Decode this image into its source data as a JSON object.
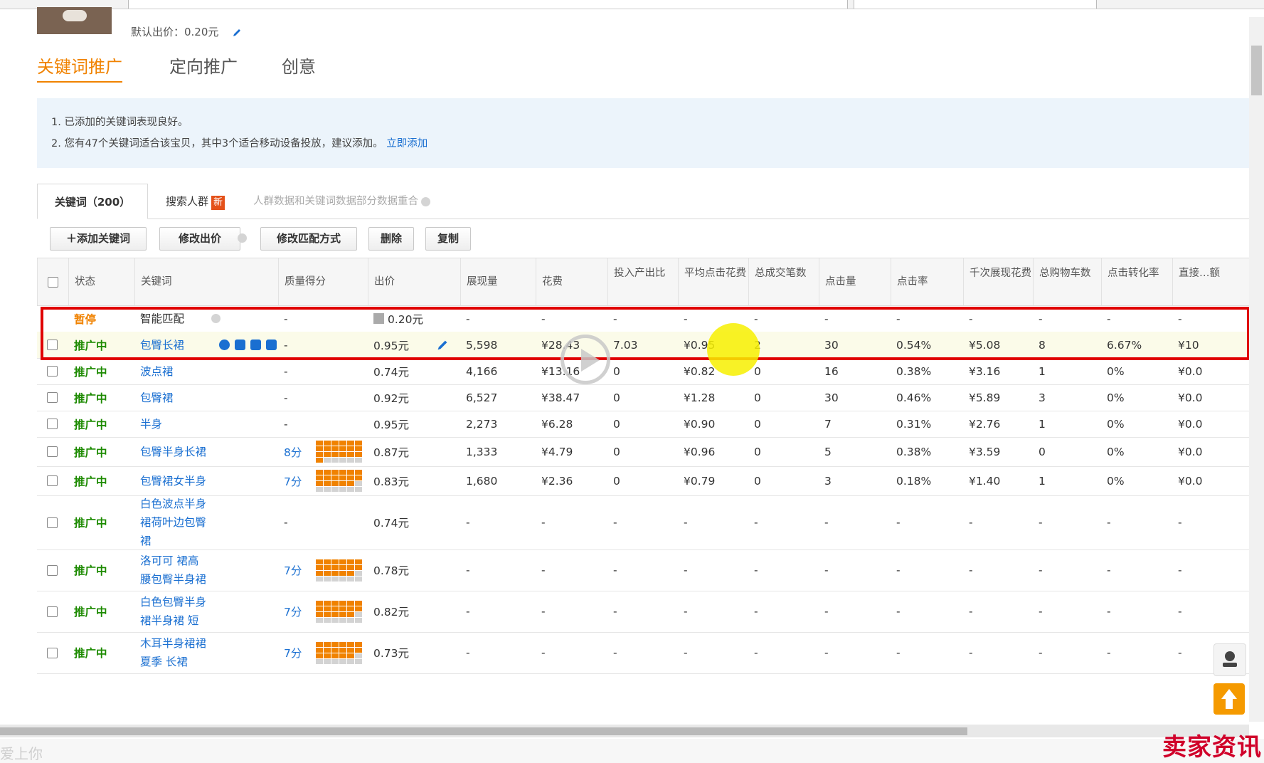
{
  "default_bid": "默认出价：0.20元",
  "tabs": [
    "关键词推广",
    "定向推广",
    "创意"
  ],
  "notice": {
    "line1": "1. 已添加的关键词表现良好。",
    "line2": "2. 您有47个关键词适合该宝贝，其中3个适合移动设备投放，建议添加。",
    "line2_link": "立即添加"
  },
  "subtabs": {
    "keywords": "关键词（200）",
    "search_crowd": "搜索人群",
    "new_badge": "新",
    "note": "人群数据和关键词数据部分数据重合"
  },
  "toolbar": {
    "add_keyword": "＋添加关键词",
    "modify_bid": "修改出价",
    "modify_match": "修改匹配方式",
    "delete": "删除",
    "copy": "复制"
  },
  "columns": [
    "状态",
    "关键词",
    "质量得分",
    "出价",
    "展现量",
    "花费",
    "投入产出比",
    "平均点击花费",
    "总成交笔数",
    "点击量",
    "点击率",
    "千次展现花费",
    "总购物车数",
    "点击转化率",
    "直接…额"
  ],
  "rows": [
    {
      "status": "暂停",
      "status_type": "pause",
      "keyword": "智能匹配",
      "score": "-",
      "quality": null,
      "bid": "0.20元",
      "impr": "-",
      "cost": "-",
      "roi": "-",
      "cpc": "-",
      "orders": "-",
      "clicks": "-",
      "ctr": "-",
      "cpm": "-",
      "cart": "-",
      "cvr": "-",
      "direct": "-"
    },
    {
      "status": "推广中",
      "status_type": "on",
      "keyword": "包臀长裙",
      "score": "-",
      "quality": null,
      "bid": "0.95元",
      "impr": "5,598",
      "cost": "¥28.43",
      "roi": "7.03",
      "cpc": "¥0.95",
      "orders": "2",
      "clicks": "30",
      "ctr": "0.54%",
      "cpm": "¥5.08",
      "cart": "8",
      "cvr": "6.67%",
      "direct": "¥10"
    },
    {
      "status": "推广中",
      "status_type": "on",
      "keyword": "波点裙",
      "score": "-",
      "quality": null,
      "bid": "0.74元",
      "impr": "4,166",
      "cost": "¥13.16",
      "roi": "0",
      "cpc": "¥0.82",
      "orders": "0",
      "clicks": "16",
      "ctr": "0.38%",
      "cpm": "¥3.16",
      "cart": "1",
      "cvr": "0%",
      "direct": "¥0.0"
    },
    {
      "status": "推广中",
      "status_type": "on",
      "keyword": "包臀裙",
      "score": "-",
      "quality": null,
      "bid": "0.92元",
      "impr": "6,527",
      "cost": "¥38.47",
      "roi": "0",
      "cpc": "¥1.28",
      "orders": "0",
      "clicks": "30",
      "ctr": "0.46%",
      "cpm": "¥5.89",
      "cart": "3",
      "cvr": "0%",
      "direct": "¥0.0"
    },
    {
      "status": "推广中",
      "status_type": "on",
      "keyword": "半身",
      "score": "-",
      "quality": null,
      "bid": "0.95元",
      "impr": "2,273",
      "cost": "¥6.28",
      "roi": "0",
      "cpc": "¥0.90",
      "orders": "0",
      "clicks": "7",
      "ctr": "0.31%",
      "cpm": "¥2.76",
      "cart": "1",
      "cvr": "0%",
      "direct": "¥0.0"
    },
    {
      "status": "推广中",
      "status_type": "on",
      "keyword": "包臀半身长裙",
      "score": "8分",
      "quality": 8,
      "bid": "0.87元",
      "impr": "1,333",
      "cost": "¥4.79",
      "roi": "0",
      "cpc": "¥0.96",
      "orders": "0",
      "clicks": "5",
      "ctr": "0.38%",
      "cpm": "¥3.59",
      "cart": "0",
      "cvr": "0%",
      "direct": "¥0.0"
    },
    {
      "status": "推广中",
      "status_type": "on",
      "keyword": "包臀裙女半身",
      "score": "7分",
      "quality": 7,
      "bid": "0.83元",
      "impr": "1,680",
      "cost": "¥2.36",
      "roi": "0",
      "cpc": "¥0.79",
      "orders": "0",
      "clicks": "3",
      "ctr": "0.18%",
      "cpm": "¥1.40",
      "cart": "1",
      "cvr": "0%",
      "direct": "¥0.0"
    },
    {
      "status": "推广中",
      "status_type": "on",
      "keyword": "白色波点半身裙荷叶边包臀裙",
      "score": "-",
      "quality": null,
      "bid": "0.74元",
      "impr": "-",
      "cost": "-",
      "roi": "-",
      "cpc": "-",
      "orders": "-",
      "clicks": "-",
      "ctr": "-",
      "cpm": "-",
      "cart": "-",
      "cvr": "-",
      "direct": "-"
    },
    {
      "status": "推广中",
      "status_type": "on",
      "keyword": "洛可可 裙高腰包臀半身裙",
      "score": "7分",
      "quality": 7,
      "bid": "0.78元",
      "impr": "-",
      "cost": "-",
      "roi": "-",
      "cpc": "-",
      "orders": "-",
      "clicks": "-",
      "ctr": "-",
      "cpm": "-",
      "cart": "-",
      "cvr": "-",
      "direct": "-"
    },
    {
      "status": "推广中",
      "status_type": "on",
      "keyword": "白色包臀半身裙半身裙 短",
      "score": "7分",
      "quality": 7,
      "bid": "0.82元",
      "impr": "-",
      "cost": "-",
      "roi": "-",
      "cpc": "-",
      "orders": "-",
      "clicks": "-",
      "ctr": "-",
      "cpm": "-",
      "cart": "-",
      "cvr": "-",
      "direct": "-"
    },
    {
      "status": "推广中",
      "status_type": "on",
      "keyword": "木耳半身裙裙夏季 长裙",
      "score": "7分",
      "quality": 7,
      "bid": "0.73元",
      "impr": "-",
      "cost": "-",
      "roi": "-",
      "cpc": "-",
      "orders": "-",
      "clicks": "-",
      "ctr": "-",
      "cpm": "-",
      "cart": "-",
      "cvr": "-",
      "direct": "-"
    }
  ],
  "colors": {
    "accent": "#f08200",
    "link": "#1a6fd1",
    "active_status": "#1c8a00",
    "highlight_border": "#e00000"
  },
  "statusbar_ticker": "爱上你",
  "watermark": "卖家资讯",
  "icons": [
    "edit-pencil-icon",
    "question-icon",
    "sort-arrow-icon",
    "play-overlay-icon",
    "customer-service-icon",
    "back-to-top-icon"
  ]
}
